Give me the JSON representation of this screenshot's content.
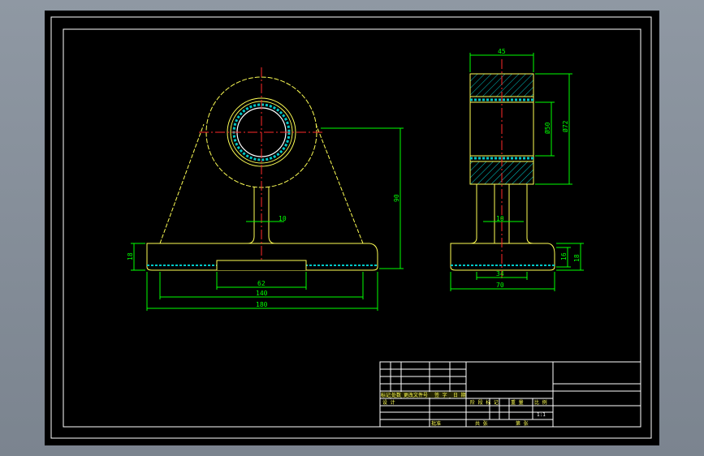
{
  "colors": {
    "background": "#000000",
    "outline": "#ffffff",
    "part": "#ffff55",
    "hatch": "#00c8c8",
    "dimension": "#00ff00",
    "centerline": "#ff2a2a"
  },
  "front_view": {
    "dims": {
      "bore": "10",
      "base_slot": "62",
      "inner_span": "140",
      "overall_width": "180",
      "height": "90",
      "base_height": "18"
    }
  },
  "side_view": {
    "dims": {
      "top_width": "45",
      "hub_diameter": "Ø72",
      "inner_diameter": "Ø50",
      "web": "10",
      "base_width_small": "34",
      "base_width": "70",
      "base_height_inner": "16",
      "base_height": "18"
    }
  },
  "title_block": {
    "left_row_labels": [
      "标记",
      "处数",
      "更改文件号",
      "签 字",
      "日 期"
    ],
    "row_design": "设 计",
    "row_approve": "批准",
    "stage_header": "阶 段 标 记",
    "weight_header": "重 量",
    "scale_header": "比 例",
    "scale_value": "1:1",
    "sheets_total": "共  张",
    "sheet_no": "第  张"
  }
}
